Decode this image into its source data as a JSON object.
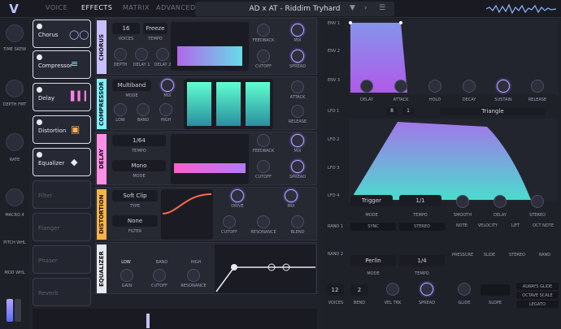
{
  "topbar": {
    "tabs": [
      "VOICE",
      "EFFECTS",
      "MATRIX",
      "ADVANCED"
    ],
    "preset": "AD x AT -  Riddim Tryhard"
  },
  "left": {
    "time_skew": "TIME SKEW",
    "depth_fmt": "DEPTH FMT",
    "rate": "RATE",
    "macro": "MACRO 4",
    "pitch": "PITCH WHL",
    "mod": "MOD WHL"
  },
  "fx": {
    "chorus": "Chorus",
    "compressor": "Compressor",
    "delay": "Delay",
    "distortion": "Distortion",
    "equalizer": "Equalizer",
    "filter": "Filter",
    "flanger": "Flanger",
    "phaser": "Phaser",
    "reverb": "Reverb"
  },
  "chorus": {
    "label": "CHORUS",
    "voices_val": "16",
    "voices": "VOICES",
    "tempo_val": "Freeze",
    "tempo": "TEMPO",
    "feedback": "FEEDBACK",
    "mix": "MIX",
    "depth": "DEPTH",
    "delay1": "DELAY 1",
    "delay2": "DELAY 2",
    "cutoff": "CUTOFF",
    "spread": "SPREAD"
  },
  "comp": {
    "label": "COMPRESSOR",
    "mode_val": "Multiband",
    "mode": "MODE",
    "mix": "MIX",
    "low": "LOW",
    "band": "BAND",
    "high": "HIGH",
    "attack": "ATTACK",
    "release": "RELEASE"
  },
  "delay": {
    "label": "DELAY",
    "tempo_val": "1/64",
    "tempo": "TEMPO",
    "mode_val": "Mono",
    "mode": "MODE",
    "feedback": "FEEDBACK",
    "mix": "MIX",
    "cutoff": "CUTOFF",
    "spread": "SPREAD"
  },
  "dist": {
    "label": "DISTORTION",
    "type_val": "Soft Clip",
    "type": "TYPE",
    "filter_val": "None",
    "filter": "FILTER",
    "drive": "DRIVE",
    "mix": "MIX",
    "cutoff": "CUTOFF",
    "resonance": "RESONANCE",
    "blend": "BLEND"
  },
  "eq": {
    "label": "EQUALIZER",
    "low": "LOW",
    "band": "BAND",
    "high": "HIGH",
    "gain": "GAIN",
    "cutoff": "CUTOFF",
    "resonance": "RESONANCE"
  },
  "env": {
    "env1": "ENV 1",
    "env2": "ENV 2",
    "env3": "ENV 3",
    "delay": "DELAY",
    "attack": "ATTACK",
    "hold": "HOLD",
    "decay": "DECAY",
    "sustain": "SUSTAIN",
    "release": "RELEASE"
  },
  "lfo": {
    "lfo1": "LFO 1",
    "lfo2": "LFO 2",
    "lfo3": "LFO 3",
    "lfo4": "LFO 4",
    "count": "8",
    "page": "1",
    "shape": "Triangle",
    "mode_val": "Trigger",
    "mode": "MODE",
    "tempo_val": "1/1",
    "tempo": "TEMPO",
    "smooth": "SMOOTH",
    "delay": "DELAY",
    "stereo": "STEREO"
  },
  "rand": {
    "rand1": "RAND 1",
    "rand2": "RAND 2",
    "sync": "SYNC",
    "stereo": "STEREO",
    "mode_val": "Perlin",
    "mode": "MODE",
    "tempo_val": "1/4",
    "tempo": "TEMPO"
  },
  "mods": {
    "note": "NOTE",
    "velocity": "VELOCITY",
    "lift": "LIFT",
    "oct": "OCT NOTE",
    "pressure": "PRESSURE",
    "slide": "SLIDE",
    "stereo": "STEREO",
    "rand": "RAND"
  },
  "voice": {
    "voices_val": "12",
    "voices": "VOICES",
    "bend_val": "2",
    "bend": "BEND",
    "veltrk": "VEL TRK",
    "spread": "SPREAD",
    "glide": "GLIDE",
    "slope": "SLOPE",
    "always": "ALWAYS GLIDE",
    "octave": "OCTAVE SCALE",
    "legato": "LEGATO"
  }
}
